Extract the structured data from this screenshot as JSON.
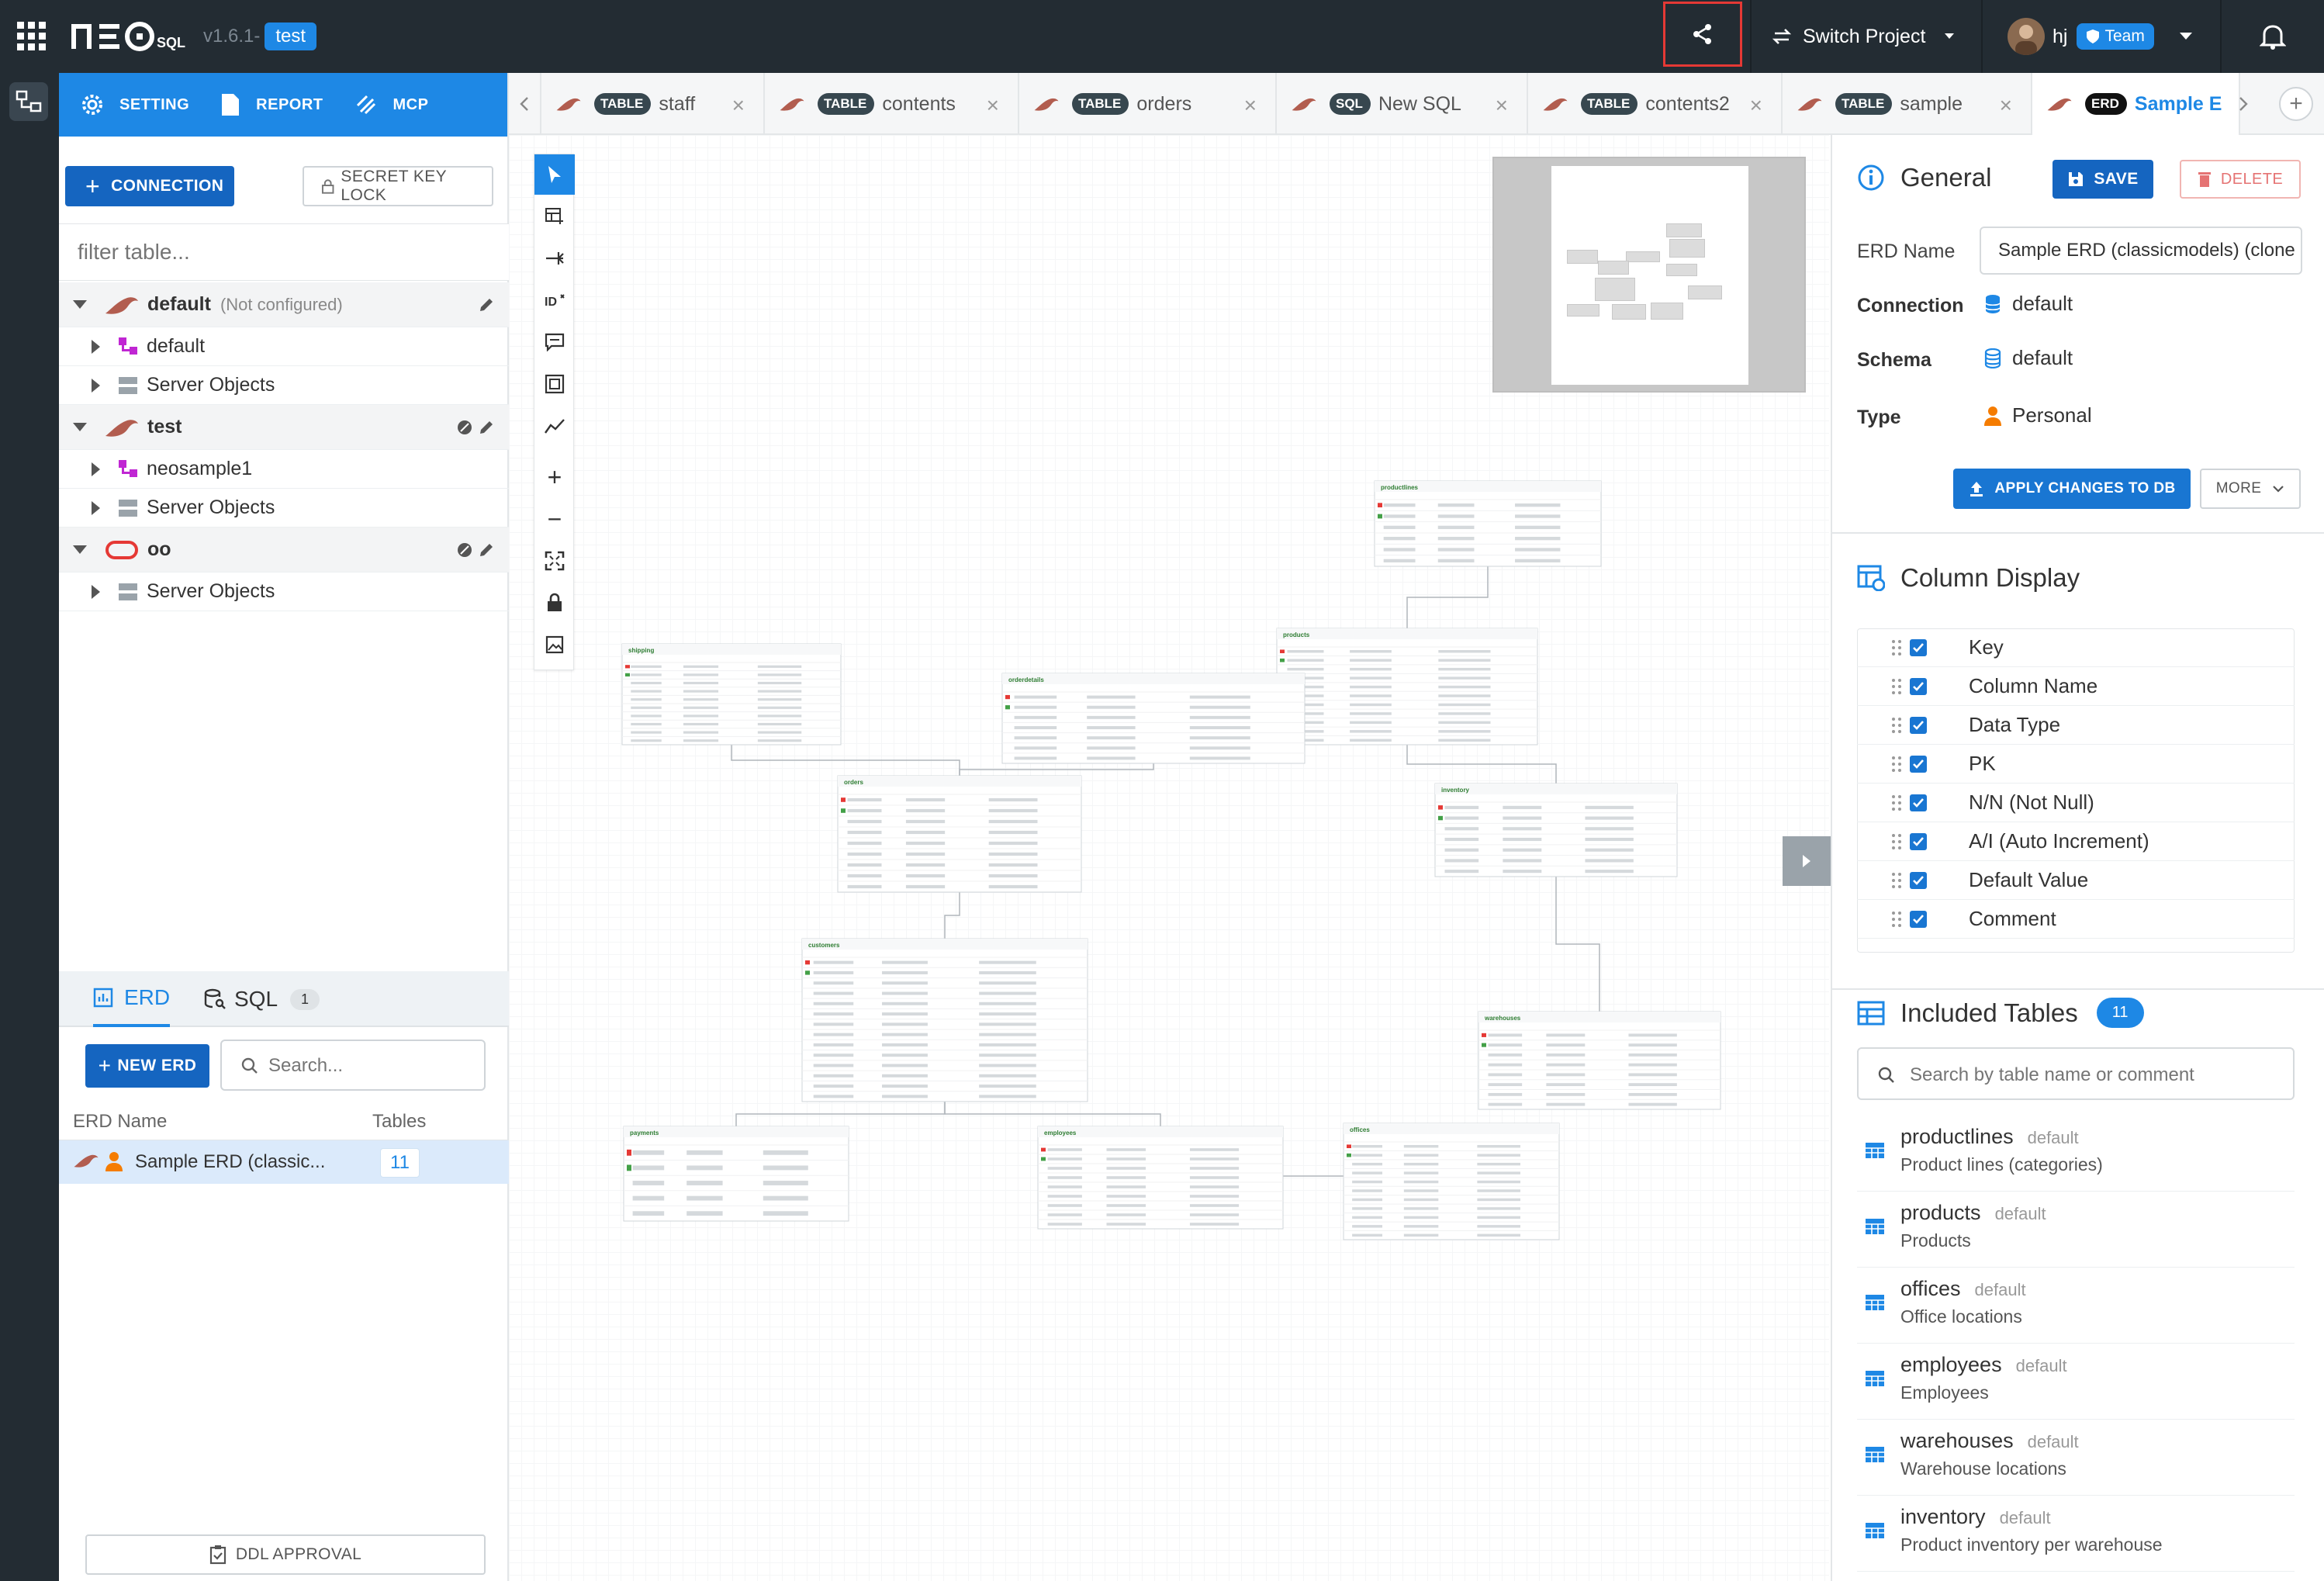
{
  "app": {
    "version": "v1.6.1-",
    "project": "test"
  },
  "topbar": {
    "switch_project": "Switch Project",
    "user_name": "hj",
    "team_badge": "Team"
  },
  "left_panel": {
    "header": {
      "setting": "SETTING",
      "report": "REPORT",
      "mcp": "MCP"
    },
    "connection_button": "CONNECTION",
    "secret_key_lock": "SECRET KEY LOCK",
    "filter_placeholder": "filter table...",
    "tree": [
      {
        "label": "default",
        "note": "(Not configured)",
        "children": [
          "default",
          "Server Objects"
        ]
      },
      {
        "label": "test",
        "note": "",
        "children": [
          "neosample1",
          "Server Objects"
        ]
      },
      {
        "label": "oo",
        "note": "",
        "children": [
          "Server Objects"
        ]
      }
    ],
    "bottom_tabs": {
      "erd": "ERD",
      "sql": "SQL",
      "sql_count": "1"
    },
    "new_erd_button": "NEW ERD",
    "search_placeholder": "Search...",
    "erd_list": {
      "col_name": "ERD Name",
      "col_tables": "Tables",
      "rows": [
        {
          "name": "Sample ERD (classic...",
          "tables": "11"
        }
      ]
    },
    "ddl_approval": "DDL APPROVAL"
  },
  "tabs": [
    {
      "type": "TABLE",
      "label": "staff"
    },
    {
      "type": "TABLE",
      "label": "contents"
    },
    {
      "type": "TABLE",
      "label": "orders"
    },
    {
      "type": "SQL",
      "label": "New SQL"
    },
    {
      "type": "TABLE",
      "label": "contents2"
    },
    {
      "type": "TABLE",
      "label": "sample"
    },
    {
      "type": "ERD",
      "label": "Sample E"
    }
  ],
  "erd_canvas": {
    "tables": [
      "productlines",
      "products",
      "orderdetails",
      "shipping",
      "orders",
      "inventory",
      "customers",
      "warehouses",
      "payments",
      "employees",
      "offices"
    ]
  },
  "right_panel": {
    "general": {
      "title": "General",
      "save": "SAVE",
      "delete": "DELETE",
      "erd_name_label": "ERD Name",
      "erd_name_value": "Sample ERD (classicmodels) (clone",
      "connection_label": "Connection",
      "connection_value": "default",
      "schema_label": "Schema",
      "schema_value": "default",
      "type_label": "Type",
      "type_value": "Personal",
      "apply_changes": "APPLY CHANGES TO DB",
      "more": "MORE"
    },
    "column_display": {
      "title": "Column Display",
      "items": [
        "Key",
        "Column Name",
        "Data Type",
        "PK",
        "N/N (Not Null)",
        "A/I (Auto Increment)",
        "Default Value",
        "Comment"
      ]
    },
    "included_tables": {
      "title": "Included Tables",
      "count": "11",
      "search_placeholder": "Search by table name or comment",
      "items": [
        {
          "name": "productlines",
          "schema": "default",
          "comment": "Product lines (categories)"
        },
        {
          "name": "products",
          "schema": "default",
          "comment": "Products"
        },
        {
          "name": "offices",
          "schema": "default",
          "comment": "Office locations"
        },
        {
          "name": "employees",
          "schema": "default",
          "comment": "Employees"
        },
        {
          "name": "warehouses",
          "schema": "default",
          "comment": "Warehouse locations"
        },
        {
          "name": "inventory",
          "schema": "default",
          "comment": "Product inventory per warehouse"
        }
      ]
    }
  },
  "colors": {
    "topbar_bg": "#232c33",
    "primary": "#1e88e5",
    "primary_dark": "#1565c0",
    "danger": "#e53935",
    "highlight_border": "#e53935"
  }
}
